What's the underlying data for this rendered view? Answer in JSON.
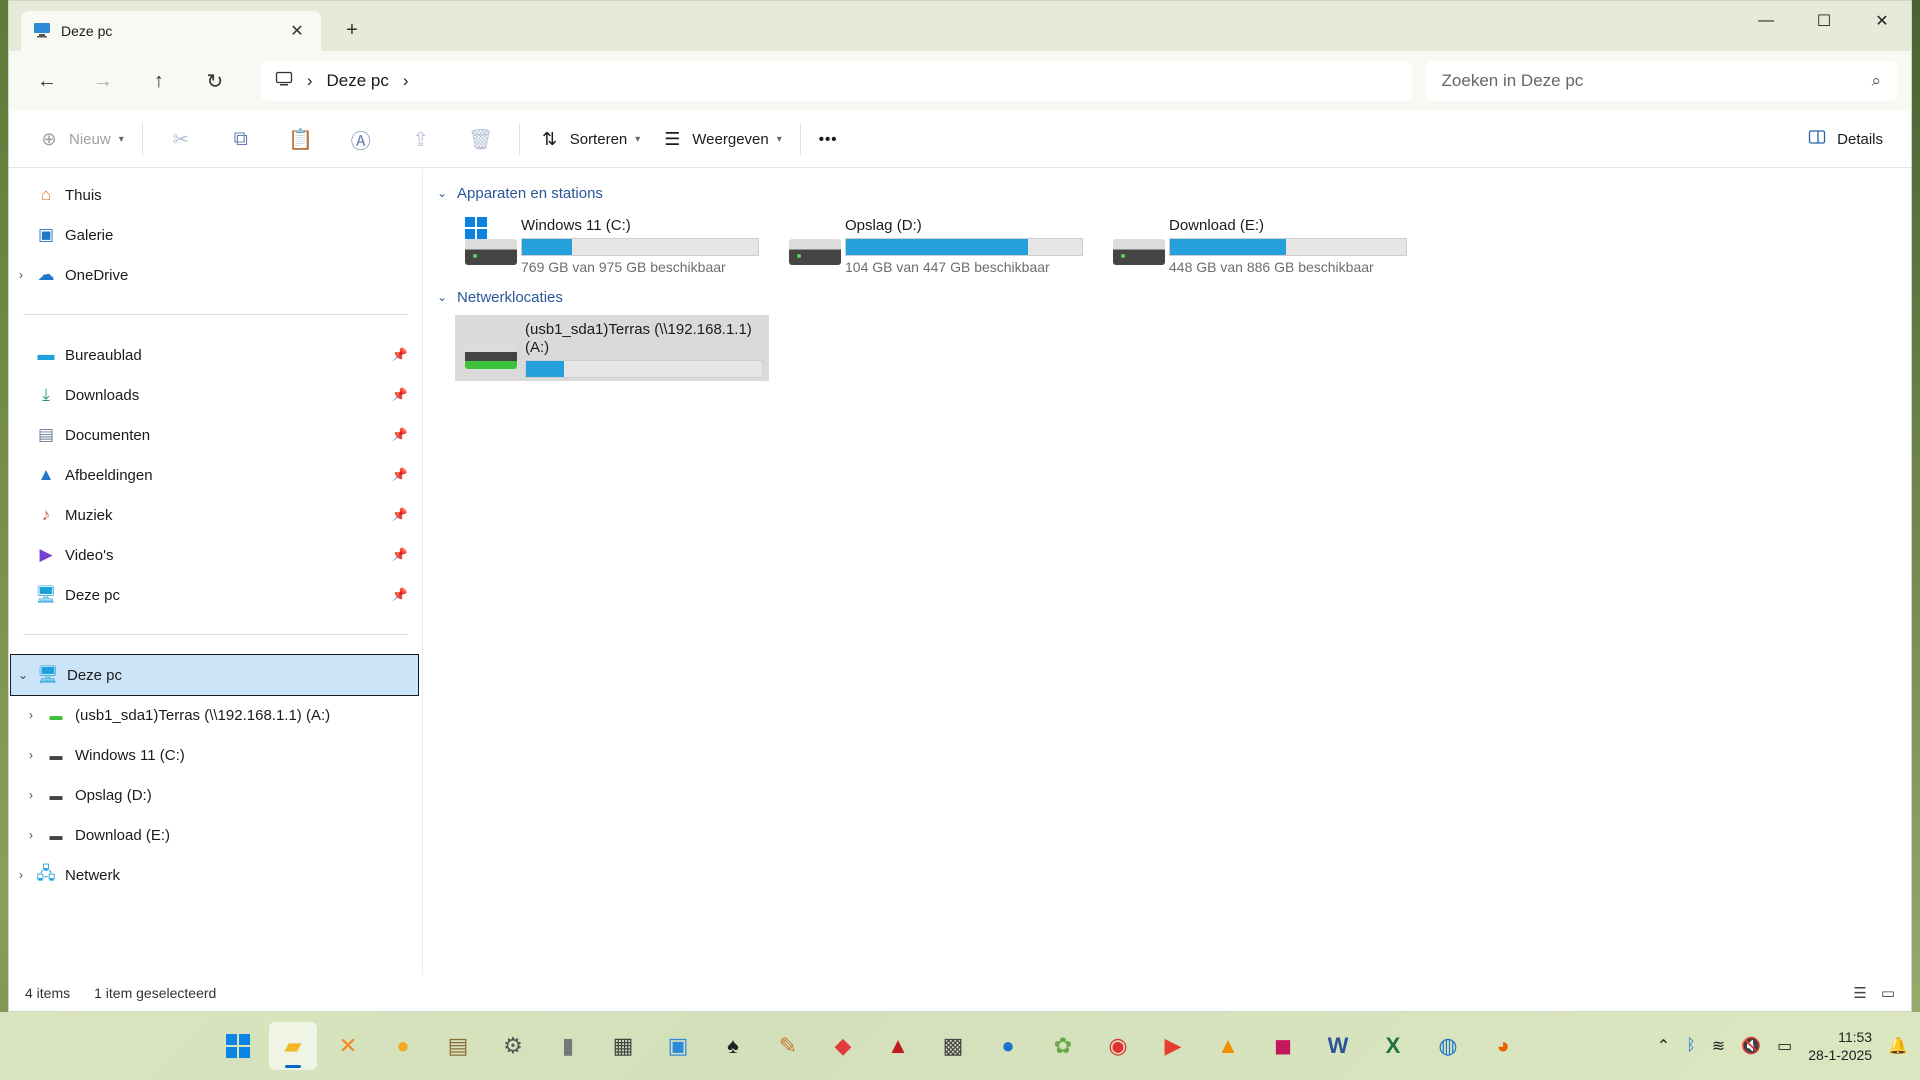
{
  "window": {
    "tab_title": "Deze pc",
    "close_tab": "✕",
    "new_tab": "+",
    "minimize": "—",
    "maximize": "☐",
    "close": "✕"
  },
  "address": {
    "back": "←",
    "forward": "→",
    "up": "↑",
    "refresh": "↻",
    "breadcrumb": "Deze pc",
    "crumb_sep": "›",
    "search_placeholder": "Zoeken in Deze pc",
    "search_icon": "⌕"
  },
  "toolbar": {
    "new_label": "Nieuw",
    "sort_label": "Sorteren",
    "view_label": "Weergeven",
    "more_label": "•••",
    "details_label": "Details"
  },
  "nav": {
    "quick": [
      {
        "label": "Thuis",
        "icon": "home-icon"
      },
      {
        "label": "Galerie",
        "icon": "gallery-icon"
      },
      {
        "label": "OneDrive",
        "icon": "cloud-icon"
      }
    ],
    "pinned": [
      {
        "label": "Bureaublad",
        "icon": "desktop-icon"
      },
      {
        "label": "Downloads",
        "icon": "download-icon"
      },
      {
        "label": "Documenten",
        "icon": "document-icon"
      },
      {
        "label": "Afbeeldingen",
        "icon": "pictures-icon"
      },
      {
        "label": "Muziek",
        "icon": "music-icon"
      },
      {
        "label": "Video's",
        "icon": "video-icon"
      },
      {
        "label": "Deze pc",
        "icon": "pc-icon"
      }
    ],
    "tree": {
      "root": "Deze pc",
      "children": [
        "(usb1_sda1)Terras (\\\\192.168.1.1) (A:)",
        "Windows 11 (C:)",
        "Opslag (D:)",
        "Download (E:)"
      ],
      "network": "Netwerk"
    }
  },
  "main": {
    "group_devices": "Apparaten en stations",
    "group_network": "Netwerklocaties",
    "drives": [
      {
        "name": "Windows 11 (C:)",
        "free": "769 GB van 975 GB beschikbaar",
        "used_fraction": 0.21
      },
      {
        "name": "Opslag (D:)",
        "free": "104 GB van 447 GB beschikbaar",
        "used_fraction": 0.77
      },
      {
        "name": "Download (E:)",
        "free": "448 GB van 886 GB beschikbaar",
        "used_fraction": 0.49
      }
    ],
    "network_drive": {
      "name": "(usb1_sda1)Terras (\\\\192.168.1.1) (A:)",
      "used_fraction": 0.16
    }
  },
  "status": {
    "items": "4 items",
    "selected": "1 item geselecteerd"
  },
  "taskbar": {
    "time": "11:53",
    "date": "28-1-2025"
  },
  "colors": {
    "accent": "#26a0da",
    "selection": "#cce4f7",
    "group_header": "#2b579a"
  }
}
